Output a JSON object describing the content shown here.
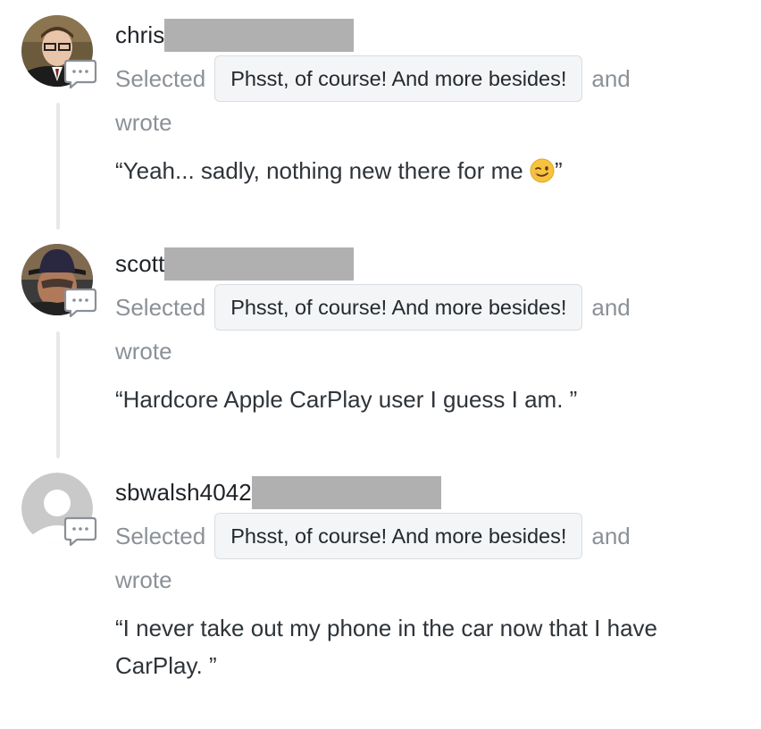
{
  "entries": [
    {
      "username": "chris",
      "selected_label": "Selected",
      "selection": "Phsst, of course! And more besides!",
      "and_label": "and",
      "wrote_label": "wrote",
      "quote": "“Yeah... sadly, nothing new there for me ",
      "quote_tail": "”",
      "emoji": "winking-face-emoji",
      "avatar": "person-photo-avatar"
    },
    {
      "username": "scott",
      "selected_label": "Selected",
      "selection": "Phsst, of course! And more besides!",
      "and_label": "and",
      "wrote_label": "wrote",
      "quote": "“Hardcore Apple CarPlay user I guess I am. ”",
      "avatar": "person-with-hat-avatar"
    },
    {
      "username": "sbwalsh4042",
      "selected_label": "Selected",
      "selection": "Phsst, of course! And more besides!",
      "and_label": "and",
      "wrote_label": "wrote",
      "quote_line1": "“I never take out my phone in the car now that I have",
      "quote_line2": "CarPlay. ”",
      "avatar": "default-user-avatar"
    }
  ],
  "icons": {
    "comment": "speech-bubble-icon"
  },
  "colors": {
    "redaction": "#b0b0b0",
    "chip_background": "#f3f5f7",
    "chip_border": "#d9dde1",
    "thread_line": "#e7e8ea",
    "muted_text": "#8b9197"
  }
}
